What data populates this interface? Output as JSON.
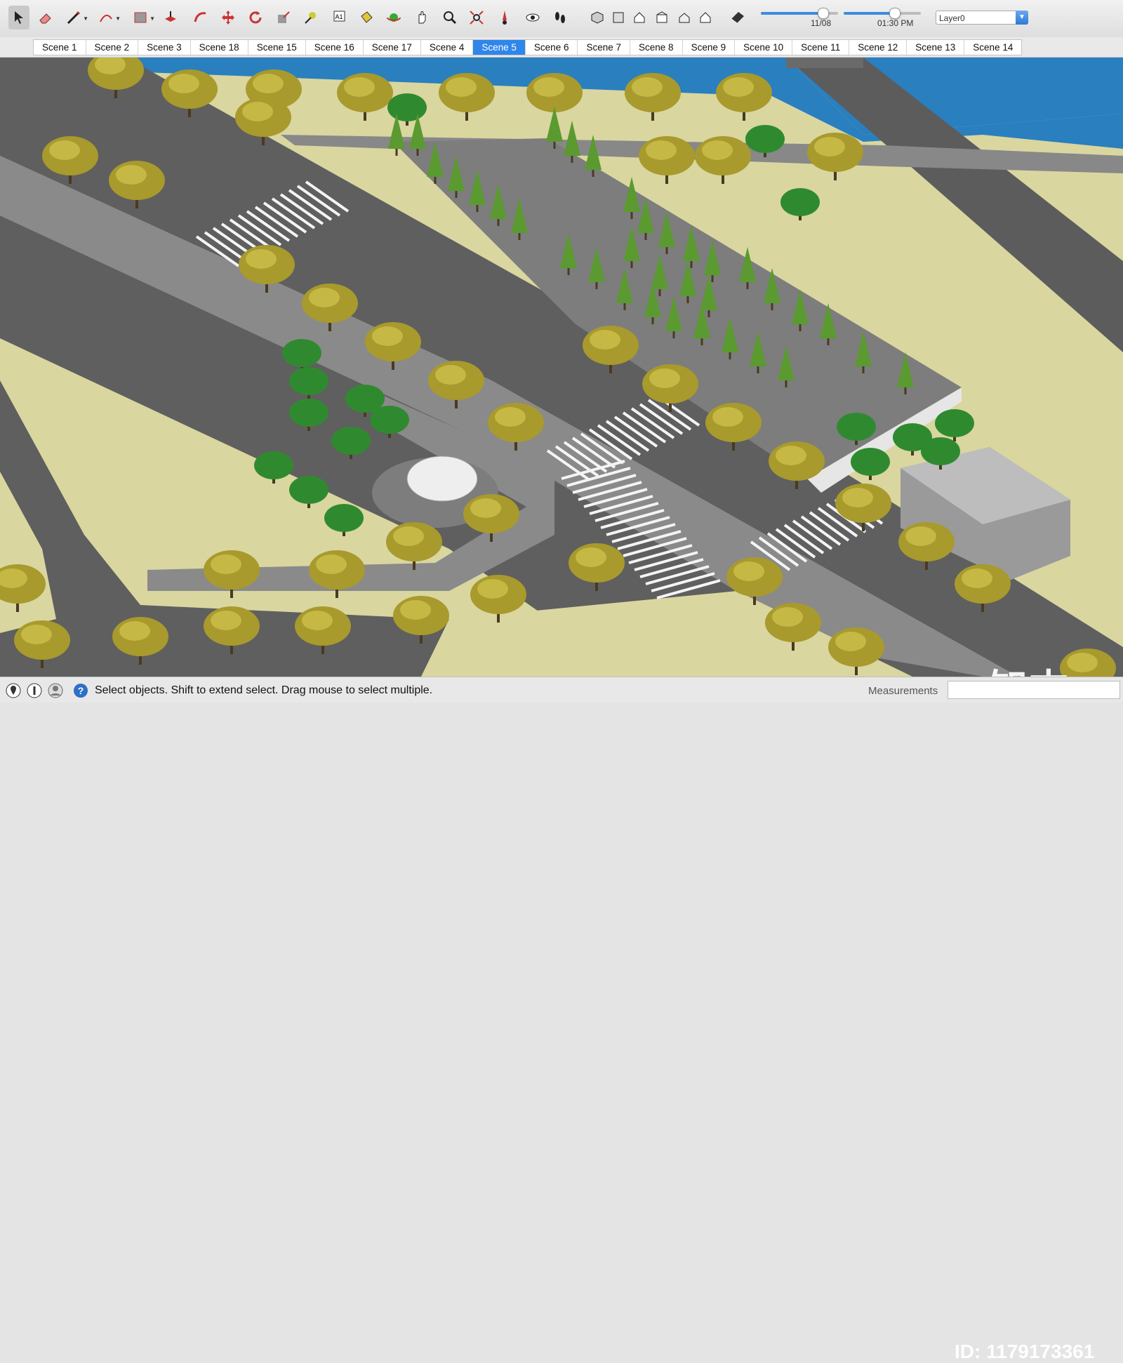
{
  "toolbar": {
    "tools": [
      {
        "name": "select-tool-icon",
        "active": true
      },
      {
        "name": "eraser-tool-icon"
      },
      {
        "name": "line-tool-icon",
        "dropdown": true
      },
      {
        "name": "arc-tool-icon",
        "dropdown": true
      },
      {
        "name": "rectangle-tool-icon",
        "dropdown": true
      },
      {
        "name": "push-pull-tool-icon"
      },
      {
        "name": "follow-me-tool-icon"
      },
      {
        "name": "move-tool-icon"
      },
      {
        "name": "rotate-tool-icon"
      },
      {
        "name": "scale-tool-icon"
      },
      {
        "name": "tape-measure-tool-icon"
      },
      {
        "name": "text-tool-icon"
      },
      {
        "name": "paint-bucket-tool-icon"
      },
      {
        "name": "orbit-tool-icon"
      },
      {
        "name": "pan-tool-icon"
      },
      {
        "name": "zoom-tool-icon"
      },
      {
        "name": "zoom-extents-tool-icon"
      },
      {
        "name": "position-camera-tool-icon"
      },
      {
        "name": "look-around-tool-icon"
      },
      {
        "name": "walk-tool-icon"
      },
      {
        "name": "iso-view-icon"
      },
      {
        "name": "top-view-icon"
      },
      {
        "name": "front-view-icon"
      },
      {
        "name": "right-view-icon"
      },
      {
        "name": "back-view-icon"
      },
      {
        "name": "left-view-icon"
      },
      {
        "name": "section-plane-tool-icon"
      }
    ],
    "shadow_date": {
      "label": "11/08",
      "value": 0.8
    },
    "shadow_time": {
      "label": "01:30 PM",
      "value": 0.65
    },
    "layer": "Layer0"
  },
  "scenes": [
    "Scene 1",
    "Scene 2",
    "Scene 3",
    "Scene 18",
    "Scene 15",
    "Scene 16",
    "Scene 17",
    "Scene 4",
    "Scene 5",
    "Scene 6",
    "Scene 7",
    "Scene 8",
    "Scene 9",
    "Scene 10",
    "Scene 11",
    "Scene 12",
    "Scene 13",
    "Scene 14"
  ],
  "active_scene": "Scene 5",
  "status": {
    "message": "Select objects. Shift to extend select. Drag mouse to select multiple.",
    "measurements_label": "Measurements",
    "measurements_value": ""
  },
  "watermark": {
    "logo": "知末",
    "id": "ID: 1179173361"
  },
  "colors": {
    "accent": "#2f86ea",
    "water": "#2a7fbf",
    "road": "#5f5f5f",
    "lawn": "#d9d6a0",
    "paving": "#8d8d8d"
  }
}
